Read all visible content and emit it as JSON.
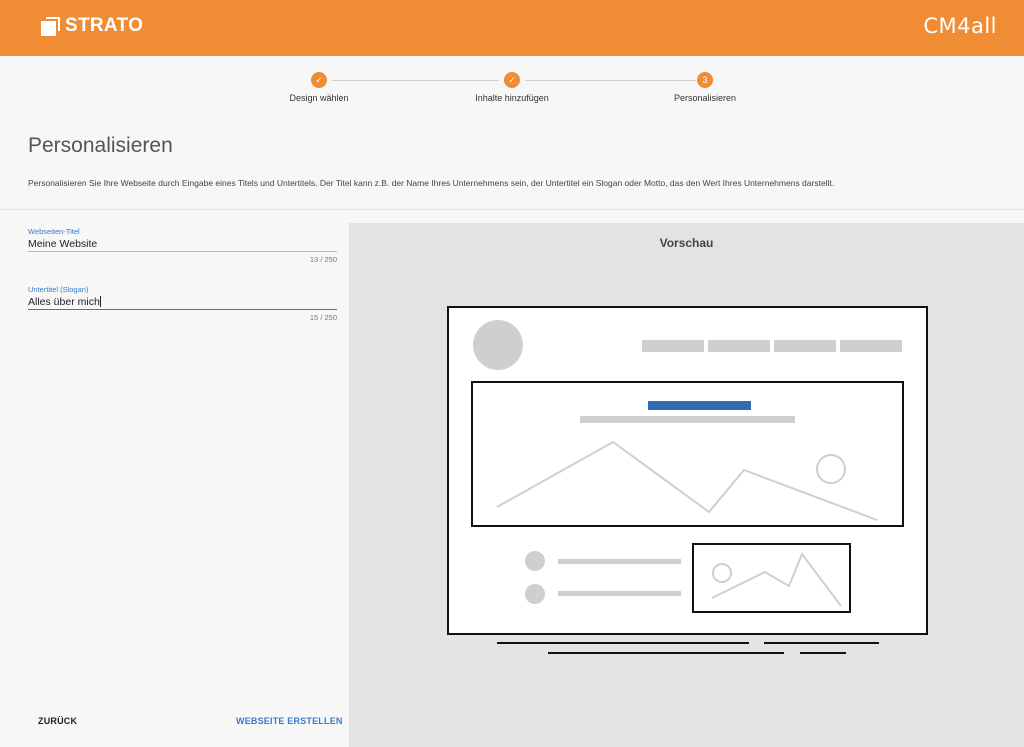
{
  "header": {
    "brand": "STRATO",
    "partner_logo": "CM4all"
  },
  "steps": [
    {
      "label": "Design wählen",
      "marker": "✓"
    },
    {
      "label": "Inhalte hinzufügen",
      "marker": "✓"
    },
    {
      "label": "Personalisieren",
      "marker": "3"
    }
  ],
  "page": {
    "title": "Personalisieren",
    "description": "Personalisieren Sie Ihre Webseite durch Eingabe eines Titels und Untertitels. Der Titel kann z.B. der Name Ihres Unternehmens sein, der Untertitel ein Slogan oder Motto, das den Wert Ihres Unternehmens darstellt."
  },
  "form": {
    "title_field": {
      "label": "Webseiten-Titel",
      "value": "Meine Website",
      "count": "13 / 250"
    },
    "subtitle_field": {
      "label": "Untertitel (Slogan)",
      "value": "Alles über mich",
      "count": "15 / 250"
    }
  },
  "actions": {
    "back": "ZURÜCK",
    "create": "WEBSEITE ERSTELLEN"
  },
  "preview": {
    "title": "Vorschau"
  },
  "colors": {
    "brand_orange": "#f08c33",
    "accent_blue": "#3a7bc8"
  }
}
